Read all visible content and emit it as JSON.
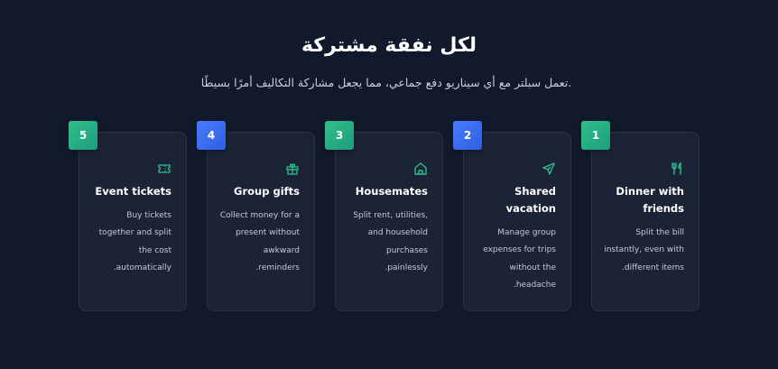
{
  "header": {
    "title": "لكل نفقة مشتركة",
    "subtitle": "تعمل سبلتر مع أي سيناريو دفع جماعي، مما يجعل مشاركة التكاليف أمرًا بسيطًا."
  },
  "colors": {
    "background": "#111a2c",
    "card": "#1b2436",
    "accent_green": "#2fbf8a",
    "accent_blue": "#4a7bff"
  },
  "cards": [
    {
      "number": "1",
      "title": "Dinner with friends",
      "description": "Split the bill instantly, even with different items.",
      "icon": "utensils-icon"
    },
    {
      "number": "2",
      "title": "Shared vacation",
      "description": "Manage group expenses for trips without the headache.",
      "icon": "plane-icon"
    },
    {
      "number": "3",
      "title": "Housemates",
      "description": "Split rent, utilities, and household purchases painlessly.",
      "icon": "home-icon"
    },
    {
      "number": "4",
      "title": "Group gifts",
      "description": "Collect money for a present without awkward reminders.",
      "icon": "gift-icon"
    },
    {
      "number": "5",
      "title": "Event tickets",
      "description": "Buy tickets together and split the cost automatically.",
      "icon": "ticket-icon"
    }
  ]
}
